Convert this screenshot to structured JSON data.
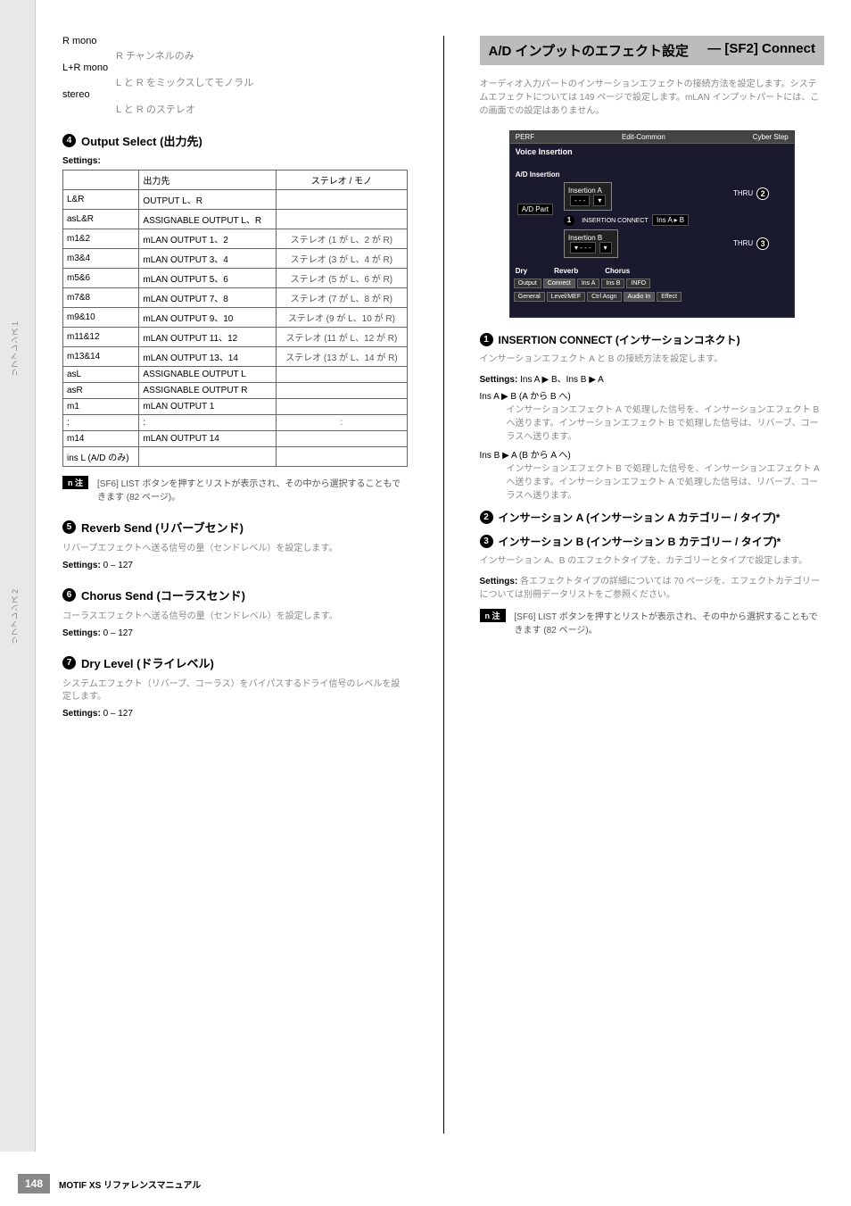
{
  "leftCol": {
    "monoBlocks": [
      {
        "label": "R mono",
        "desc": "R チャンネルのみ"
      },
      {
        "label": "L+R mono",
        "desc": "L と R をミックスしてモノラル"
      },
      {
        "label": "stereo",
        "desc": "L と R のステレオ"
      }
    ],
    "sections": {
      "outputSelect": {
        "num": "4",
        "title": "Output Select (出力先)",
        "settingsLabel": "Settings:",
        "headers": [
          "",
          "出力先",
          "ステレオ / モノ"
        ],
        "rows": [
          {
            "c1": "L&R",
            "c2": "OUTPUT L、R",
            "c3": ""
          },
          {
            "c1": "asL&R",
            "c2": "ASSIGNABLE OUTPUT L、R",
            "c3": ""
          },
          {
            "c1": "m1&2",
            "c2": "mLAN OUTPUT 1、2",
            "c3": "ステレオ (1 が L、2 が R)"
          },
          {
            "c1": "m3&4",
            "c2": "mLAN OUTPUT 3、4",
            "c3": "ステレオ (3 が L、4 が R)"
          },
          {
            "c1": "m5&6",
            "c2": "mLAN OUTPUT 5、6",
            "c3": "ステレオ (5 が L、6 が R)"
          },
          {
            "c1": "m7&8",
            "c2": "mLAN OUTPUT 7、8",
            "c3": "ステレオ (7 が L、8 が R)"
          },
          {
            "c1": "m9&10",
            "c2": "mLAN OUTPUT 9、10",
            "c3": "ステレオ (9 が L、10 が R)"
          },
          {
            "c1": "m11&12",
            "c2": "mLAN OUTPUT 11、12",
            "c3": "ステレオ (11 が L、12 が R)"
          },
          {
            "c1": "m13&14",
            "c2": "mLAN OUTPUT 13、14",
            "c3": "ステレオ (13 が L、14 が R)"
          },
          {
            "c1": "asL",
            "c2": "ASSIGNABLE OUTPUT L",
            "c3": ""
          },
          {
            "c1": "asR",
            "c2": "ASSIGNABLE OUTPUT R",
            "c3": ""
          },
          {
            "c1": "m1",
            "c2": "mLAN OUTPUT 1",
            "c3": ""
          },
          {
            "c1": ":",
            "c2": ":",
            "c3": ":"
          },
          {
            "c1": "m14",
            "c2": "mLAN OUTPUT 14",
            "c3": ""
          },
          {
            "c1": "ins L (A/D のみ)",
            "c2": "",
            "c3": ""
          }
        ],
        "note": {
          "badge": "n 注",
          "text": "[SF6] LIST ボタンを押すとリストが表示され、その中から選択することもできます (82 ページ)。"
        }
      },
      "reverbSend": {
        "num": "5",
        "title": "Reverb Send (リバーブセンド)",
        "desc": "リバーブエフェクトへ送る信号の量（センドレベル）を設定します。",
        "settings": {
          "label": "Settings:",
          "value": "0 – 127"
        }
      },
      "chorusSend": {
        "num": "6",
        "title": "Chorus Send (コーラスセンド)",
        "desc": "コーラスエフェクトへ送る信号の量（センドレベル）を設定します。",
        "settings": {
          "label": "Settings:",
          "value": "0 – 127"
        }
      },
      "dryLevel": {
        "num": "7",
        "title": "Dry Level (ドライレベル)",
        "desc": "システムエフェクト（リバーブ、コーラス）をバイパスするドライ信号のレベルを設定します。",
        "settings": {
          "label": "Settings:",
          "value": "0 – 127"
        }
      }
    }
  },
  "rightCol": {
    "headingBar": {
      "left": "A/D インプットのエフェクト設定",
      "right": "— [SF2] Connect"
    },
    "intro": "オーディオ入力パートのインサーションエフェクトの接続方法を設定します。システムエフェクトについては 149 ページで設定します。mLAN インプットパートには、この画面での設定はありません。",
    "screenshot": {
      "topLeft": "PERF",
      "topCenter": "Edit-Common",
      "topRight": "Cyber Step",
      "title": "Voice Insertion",
      "adInsertion": "A/D Insertion",
      "adPart": "A/D Part",
      "insA": "Insertion A",
      "insB": "Insertion B",
      "insConnect": "INSERTION CONNECT",
      "insConnectVal": "Ins A ▸ B",
      "thru1": "THRU",
      "thru2": "THRU",
      "scale": [
        "Dry",
        "Reverb",
        "Chorus"
      ],
      "tabsRow1": [
        "Output",
        "Connect",
        "Ins A",
        "Ins B",
        "INFO"
      ],
      "tabsRow2": [
        "General",
        "Level/MEF",
        "Ctrl Asgn",
        "Audio In",
        "Effect"
      ],
      "callouts": {
        "c1": "1",
        "c2": "2",
        "c3": "3"
      }
    },
    "insertionConnect": {
      "num": "1",
      "title": "INSERTION CONNECT (インサーションコネクト)",
      "desc": "インサーションエフェクト A と B の接続方法を設定します。",
      "settingsLabel": "Settings:",
      "settingsValue": "Ins A ▶ B、Ins B ▶ A",
      "optA": {
        "label": "Ins A ▶ B (A から B へ)",
        "desc": "インサーションエフェクト A で処理した信号を、インサーションエフェクト B へ送ります。インサーションエフェクト B で処理した信号は、リバーブ、コーラスへ送ります。"
      },
      "optB": {
        "label": "Ins B ▶ A (B から A へ)",
        "desc": "インサーションエフェクト B で処理した信号を、インサーションエフェクト A へ送ります。インサーションエフェクト A で処理した信号は、リバーブ、コーラスへ送ります。"
      }
    },
    "param2": {
      "num": "2",
      "title": "インサーション A (インサーション A カテゴリー / タイプ)*"
    },
    "param3": {
      "num": "3",
      "title": "インサーション B (インサーション B カテゴリー / タイプ)*",
      "desc": "インサーション A、B のエフェクトタイプを、カテゴリーとタイプで設定します。",
      "settings": {
        "label": "Settings:",
        "value": "各エフェクトタイプの詳細については 70 ページを、エフェクトカテゴリーについては別冊データリストをご参照ください。"
      },
      "note": {
        "badge": "n 注",
        "text": "[SF6] LIST ボタンを押すとリストが表示され、その中から選択することもできます (82 ページ)。"
      }
    }
  },
  "footer": {
    "pageNum": "148",
    "text": "MOTIF XS リファレンスマニュアル"
  },
  "sidebarTabs": [
    "リファレンス 1",
    "リファレンス 2"
  ]
}
